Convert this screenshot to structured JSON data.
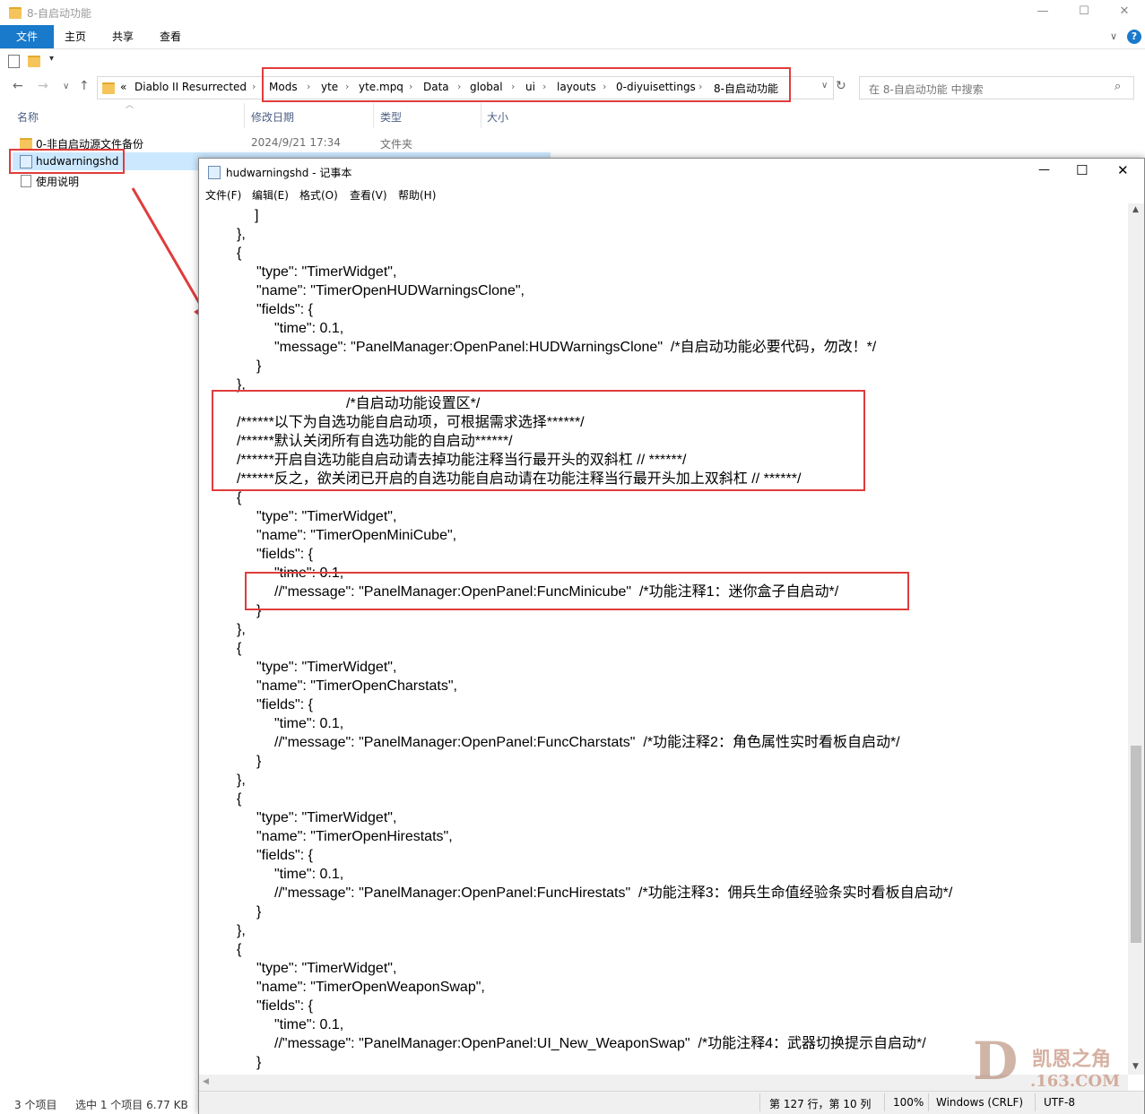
{
  "explorer": {
    "title": "8-自启动功能",
    "ribbon_tabs": [
      "文件",
      "主页",
      "共享",
      "查看"
    ],
    "breadcrumb_prefix": "«",
    "breadcrumb": [
      "Diablo II Resurrected",
      "Mods",
      "yte",
      "yte.mpq",
      "Data",
      "global",
      "ui",
      "layouts",
      "0-diyuisettings",
      "8-自启动功能"
    ],
    "search_placeholder": "在 8-自启动功能 中搜索",
    "columns": [
      "名称",
      "修改日期",
      "类型",
      "大小"
    ],
    "files": [
      {
        "name": "0-非自启动源文件备份",
        "date": "2024/9/21 17:34",
        "type": "文件夹",
        "size": ""
      },
      {
        "name": "hudwarningshd",
        "date": "",
        "type": "",
        "size": ""
      },
      {
        "name": "使用说明",
        "date": "",
        "type": "",
        "size": ""
      }
    ],
    "status": {
      "count": "3 个项目",
      "selected": "选中 1 个项目  6.77 KB"
    }
  },
  "notepad": {
    "title": "hudwarningshd - 记事本",
    "menu": [
      "文件(F)",
      "编辑(E)",
      "格式(O)",
      "查看(V)",
      "帮助(H)"
    ],
    "lines": [
      {
        "indent": 62,
        "text": "]"
      },
      {
        "indent": 42,
        "text": "},"
      },
      {
        "indent": 42,
        "text": "{"
      },
      {
        "indent": 64,
        "text": "\"type\": \"TimerWidget\","
      },
      {
        "indent": 64,
        "text": "\"name\": \"TimerOpenHUDWarningsClone\","
      },
      {
        "indent": 64,
        "text": "\"fields\": {"
      },
      {
        "indent": 84,
        "text": "\"time\": 0.1,"
      },
      {
        "indent": 84,
        "text": "\"message\": \"PanelManager:OpenPanel:HUDWarningsClone\"  /*自启动功能必要代码，勿改！*/"
      },
      {
        "indent": 64,
        "text": "}"
      },
      {
        "indent": 42,
        "text": "},"
      },
      {
        "indent": 164,
        "text": "/*自启动功能设置区*/"
      },
      {
        "indent": 42,
        "text": "/******以下为自选功能自启动项，可根据需求选择******/"
      },
      {
        "indent": 42,
        "text": "/******默认关闭所有自选功能的自启动******/"
      },
      {
        "indent": 42,
        "text": "/******开启自选功能自启动请去掉功能注释当行最开头的双斜杠 // ******/"
      },
      {
        "indent": 42,
        "text": "/******反之，欲关闭已开启的自选功能自启动请在功能注释当行最开头加上双斜杠 // ******/"
      },
      {
        "indent": 42,
        "text": "{"
      },
      {
        "indent": 64,
        "text": "\"type\": \"TimerWidget\","
      },
      {
        "indent": 64,
        "text": "\"name\": \"TimerOpenMiniCube\","
      },
      {
        "indent": 64,
        "text": "\"fields\": {"
      },
      {
        "indent": 84,
        "text": "\"time\": 0.1,"
      },
      {
        "indent": 84,
        "text": "//\"message\": \"PanelManager:OpenPanel:FuncMinicube\"  /*功能注释1：迷你盒子自启动*/"
      },
      {
        "indent": 64,
        "text": "}"
      },
      {
        "indent": 42,
        "text": "},"
      },
      {
        "indent": 42,
        "text": "{"
      },
      {
        "indent": 64,
        "text": "\"type\": \"TimerWidget\","
      },
      {
        "indent": 64,
        "text": "\"name\": \"TimerOpenCharstats\","
      },
      {
        "indent": 64,
        "text": "\"fields\": {"
      },
      {
        "indent": 84,
        "text": "\"time\": 0.1,"
      },
      {
        "indent": 84,
        "text": "//\"message\": \"PanelManager:OpenPanel:FuncCharstats\"  /*功能注释2：角色属性实时看板自启动*/"
      },
      {
        "indent": 64,
        "text": "}"
      },
      {
        "indent": 42,
        "text": "},"
      },
      {
        "indent": 42,
        "text": "{"
      },
      {
        "indent": 64,
        "text": "\"type\": \"TimerWidget\","
      },
      {
        "indent": 64,
        "text": "\"name\": \"TimerOpenHirestats\","
      },
      {
        "indent": 64,
        "text": "\"fields\": {"
      },
      {
        "indent": 84,
        "text": "\"time\": 0.1,"
      },
      {
        "indent": 84,
        "text": "//\"message\": \"PanelManager:OpenPanel:FuncHirestats\"  /*功能注释3：佣兵生命值经验条实时看板自启动*/"
      },
      {
        "indent": 64,
        "text": "}"
      },
      {
        "indent": 42,
        "text": "},"
      },
      {
        "indent": 42,
        "text": "{"
      },
      {
        "indent": 64,
        "text": "\"type\": \"TimerWidget\","
      },
      {
        "indent": 64,
        "text": "\"name\": \"TimerOpenWeaponSwap\","
      },
      {
        "indent": 64,
        "text": "\"fields\": {"
      },
      {
        "indent": 84,
        "text": "\"time\": 0.1,"
      },
      {
        "indent": 84,
        "text": "//\"message\": \"PanelManager:OpenPanel:UI_New_WeaponSwap\"  /*功能注释4：武器切换提示自启动*/"
      },
      {
        "indent": 64,
        "text": "}"
      },
      {
        "indent": 42,
        "text": "}"
      }
    ],
    "status": {
      "position": "第 127 行，第 10 列",
      "zoom": "100%",
      "eol": "Windows (CRLF)",
      "encoding": "UTF-8"
    }
  },
  "watermark": {
    "brand": "凯恩之角",
    "site": ".163.COM"
  },
  "colors": {
    "accent": "#1979ca",
    "highlight_box": "#e03c3c",
    "selection": "#cce8ff"
  }
}
